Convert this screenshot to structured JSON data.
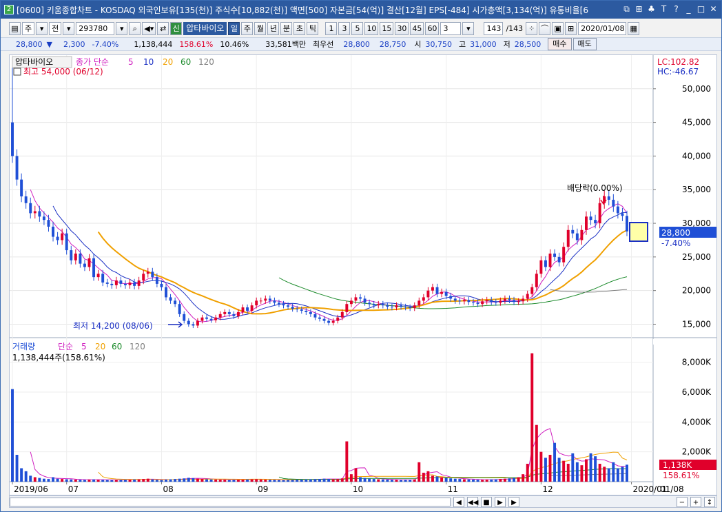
{
  "window": {
    "title": "[0600] 키움종합차트 - KOSDAQ 외국인보유[135(천)] 주식수[10,882(천)] 액면[500] 자본금[54(억)] 결산[12월] EPS[-484] 시가총액[3,134(억)] 유통비율[6",
    "app_badge": "2",
    "title_buttons": [
      "⧉",
      "⊞",
      "♣",
      "T",
      "?",
      "_",
      "□",
      "✕"
    ]
  },
  "toolbar": {
    "menu_box": "▤",
    "period": "주",
    "market": "전",
    "code": "293780",
    "name_tag": "신",
    "stock_name": "압타바이오",
    "timeframes": [
      "일",
      "주",
      "월",
      "년",
      "분",
      "초",
      "틱"
    ],
    "selected_timeframe": "일",
    "numbers": [
      "1",
      "3",
      "5",
      "10",
      "15",
      "30",
      "45",
      "60"
    ],
    "count_value": "3",
    "range": "143",
    "range_total": "/143",
    "date": "2020/01/08"
  },
  "quote": {
    "price": "28,800",
    "arrow": "▼",
    "change": "2,300",
    "change_pct": "-7.40%",
    "volume": "1,138,444",
    "volume_ratio": "158.61%",
    "turnover": "10.46%",
    "amount": "33,581백만",
    "best_label": "최우선",
    "bid1": "28,800",
    "bid2": "28,750",
    "open_label": "시",
    "open": "30,750",
    "high_label": "고",
    "high": "31,000",
    "low_label": "저",
    "low": "28,500",
    "buy_label": "매수",
    "sell_label": "매도"
  },
  "price_pane": {
    "title": "압타바이오",
    "ma_label": "종가 단순",
    "ma_periods": [
      "5",
      "10",
      "20",
      "60",
      "120"
    ],
    "high_note": "최고 54,000 (06/12)",
    "low_note": "최저 14,200 (08/06)",
    "dividend_note": "배당락(0.00%)",
    "lc": "LC:102.82",
    "hc": "HC:-46.67",
    "current": "28,800",
    "current_pct": "-7.40%"
  },
  "volume_pane": {
    "title": "거래량",
    "ma_label": "단순",
    "ma_periods": [
      "5",
      "20",
      "60",
      "120"
    ],
    "value_note": "1,138,444주(158.61%)",
    "current": "1,138K",
    "current_pct": "158.61%"
  },
  "colors": {
    "up": "#e0002b",
    "down": "#1f4fd6",
    "ma5": "#d020c0",
    "ma10": "#1a2fc4",
    "ma20": "#f0a000",
    "ma60": "#1a8a2a",
    "ma120": "#808080"
  },
  "chart_data": {
    "type": "candlestick",
    "price_axis": [
      "50,000",
      "45,000",
      "40,000",
      "35,000",
      "30,000",
      "25,000",
      "20,000",
      "15,000"
    ],
    "price_axis_values": [
      50000,
      45000,
      40000,
      35000,
      30000,
      25000,
      20000,
      15000
    ],
    "volume_axis": [
      "8,000K",
      "6,000K",
      "4,000K",
      "2,000K"
    ],
    "volume_axis_values": [
      8000,
      6000,
      4000,
      2000
    ],
    "x_labels": [
      "2019/06",
      "07",
      "08",
      "09",
      "10",
      "11",
      "12",
      "2020/01"
    ],
    "x_label_index": [
      0,
      12,
      33,
      54,
      75,
      96,
      117,
      137
    ],
    "last_date_label": "01/08",
    "ylim": [
      13000,
      55000
    ],
    "volume_ylim": [
      0,
      9000
    ],
    "closes": [
      40000,
      36500,
      34000,
      33000,
      31500,
      31800,
      31000,
      30500,
      29500,
      28000,
      27500,
      28500,
      26000,
      24500,
      25500,
      24000,
      23500,
      24800,
      22000,
      22500,
      21200,
      21000,
      20800,
      21500,
      21000,
      20800,
      21200,
      20700,
      21500,
      22500,
      22800,
      22000,
      21000,
      20500,
      19000,
      18500,
      18000,
      16500,
      15500,
      15000,
      14800,
      15500,
      16000,
      15800,
      15600,
      16000,
      16500,
      16800,
      16500,
      16200,
      16800,
      17500,
      17000,
      17800,
      18500,
      18500,
      18800,
      18500,
      18200,
      18000,
      17800,
      17600,
      17300,
      17200,
      17000,
      16800,
      16500,
      16000,
      15800,
      15500,
      15200,
      15500,
      16000,
      16800,
      18000,
      18500,
      19000,
      18800,
      18200,
      18000,
      17800,
      18000,
      17800,
      17600,
      17500,
      17800,
      17600,
      17500,
      17400,
      17800,
      18500,
      19000,
      20000,
      20500,
      19500,
      19800,
      19200,
      18800,
      18500,
      18400,
      18600,
      18300,
      18200,
      18000,
      18400,
      18600,
      18300,
      18200,
      18500,
      18800,
      18600,
      18300,
      18400,
      18800,
      19500,
      20500,
      22500,
      24500,
      23500,
      25500,
      25000,
      24200,
      26500,
      29000,
      28500,
      27500,
      29000,
      31000,
      30500,
      30000,
      33000,
      34000,
      33500,
      32500,
      31500,
      31100,
      28800
    ],
    "volumes": [
      6200,
      1800,
      900,
      700,
      400,
      300,
      250,
      200,
      180,
      300,
      200,
      180,
      160,
      150,
      140,
      130,
      120,
      140,
      150,
      130,
      120,
      110,
      100,
      110,
      120,
      130,
      140,
      150,
      160,
      180,
      200,
      150,
      120,
      110,
      140,
      160,
      180,
      200,
      220,
      260,
      240,
      200,
      180,
      160,
      150,
      140,
      130,
      120,
      110,
      120,
      130,
      140,
      150,
      160,
      170,
      150,
      140,
      130,
      120,
      110,
      100,
      110,
      120,
      130,
      140,
      150,
      160,
      170,
      180,
      200,
      180,
      160,
      170,
      220,
      2700,
      500,
      900,
      300,
      250,
      200,
      180,
      160,
      150,
      140,
      130,
      120,
      110,
      120,
      130,
      150,
      1300,
      600,
      700,
      400,
      350,
      300,
      260,
      220,
      200,
      180,
      160,
      150,
      140,
      130,
      120,
      140,
      150,
      160,
      180,
      200,
      220,
      250,
      300,
      500,
      1200,
      8600,
      3800,
      2000,
      1600,
      1800,
      2600,
      1600,
      1400,
      1200,
      1900,
      1300,
      1100,
      1500,
      1900,
      1700,
      1200,
      1000,
      900,
      1300,
      900,
      1000,
      1138
    ]
  }
}
